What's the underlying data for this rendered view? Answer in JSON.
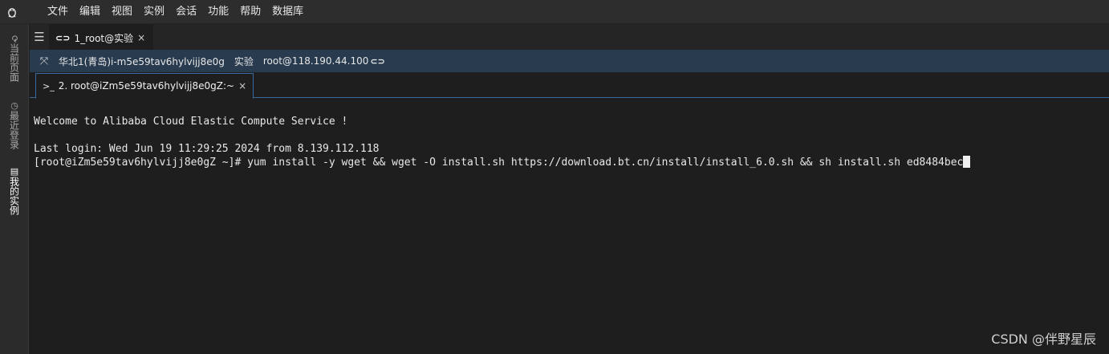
{
  "menubar": {
    "logo": "linux-penguin-icon",
    "items": [
      "文件",
      "编辑",
      "视图",
      "实例",
      "会话",
      "功能",
      "帮助",
      "数据库"
    ]
  },
  "sidebar": {
    "tabs": [
      {
        "label": "当前页面",
        "icon": "refresh-icon"
      },
      {
        "label": "最近登录",
        "icon": "clock-icon"
      },
      {
        "label": "我的实例",
        "icon": "list-icon"
      }
    ]
  },
  "session_tab": {
    "label": "1_root@实验",
    "close": "×"
  },
  "infobar": {
    "region_instance": "华北1(青岛)i-m5e59tav6hylvijj8e0g",
    "tag": "实验",
    "login": "root@118.190.44.100"
  },
  "terminal_tab": {
    "prompt_icon": ">_",
    "label": "2. root@iZm5e59tav6hylvijj8e0gZ:~",
    "close": "×"
  },
  "terminal": {
    "welcome": "Welcome to Alibaba Cloud Elastic Compute Service !",
    "last_login": "Last login: Wed Jun 19 11:29:25 2024 from 8.139.112.118",
    "prompt": "[root@iZm5e59tav6hylvijj8e0gZ ~]# ",
    "command": "yum install -y wget && wget -O install.sh https://download.bt.cn/install/install_6.0.sh && sh install.sh ed8484bec"
  },
  "watermark": "CSDN @伴野星辰",
  "colors": {
    "menubar_bg": "#2d2d2d",
    "infobar_bg": "#283b4f",
    "terminal_bg": "#1e1e1e",
    "accent": "#3a6aa0"
  }
}
